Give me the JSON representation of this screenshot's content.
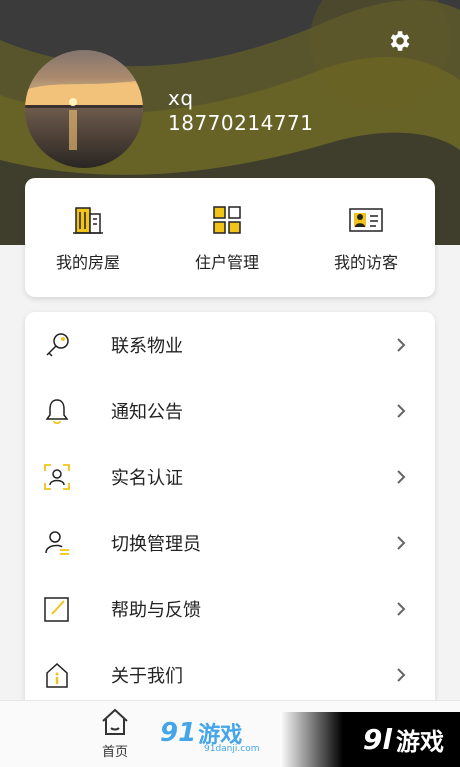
{
  "profile": {
    "name": "xq",
    "phone": "18770214771"
  },
  "quick_actions": [
    {
      "label": "我的房屋",
      "icon": "building-icon"
    },
    {
      "label": "住户管理",
      "icon": "grid-icon"
    },
    {
      "label": "我的访客",
      "icon": "id-card-icon"
    }
  ],
  "menu": [
    {
      "label": "联系物业",
      "icon": "key-icon"
    },
    {
      "label": "通知公告",
      "icon": "bell-icon"
    },
    {
      "label": "实名认证",
      "icon": "face-scan-icon"
    },
    {
      "label": "切换管理员",
      "icon": "user-switch-icon"
    },
    {
      "label": "帮助与反馈",
      "icon": "edit-icon"
    },
    {
      "label": "关于我们",
      "icon": "info-house-icon"
    }
  ],
  "tabbar": {
    "home_label": "首页"
  },
  "watermark": {
    "left_brand_num": "91",
    "left_brand_text": "游戏",
    "left_sub": "91danji.com",
    "right_brand_num": "9l",
    "right_brand_text": "游戏"
  },
  "colors": {
    "header_bg": "#3a3a3a",
    "accent_yellow": "#f0c419",
    "wave_yellow": "#6b6524"
  }
}
